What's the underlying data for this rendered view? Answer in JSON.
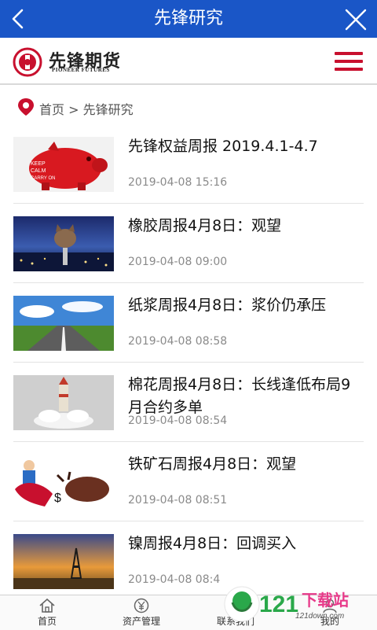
{
  "header": {
    "title": "先锋研究"
  },
  "brand": {
    "name_cn": "先锋期货",
    "name_en": "PIONEER FUTURES",
    "color": "#c8102e"
  },
  "colors": {
    "top_bar": "#1a56c7",
    "accent": "#c8102e"
  },
  "breadcrumb": {
    "text": "首页 > 先锋研究"
  },
  "articles": [
    {
      "title": "先锋权益周报 2019.4.1-4.7",
      "date": "2019-04-08 15:16",
      "thumb": "red-piggy-bank"
    },
    {
      "title": "橡胶周报4月8日：观望",
      "date": "2019-04-08 09:00",
      "thumb": "cat-city-night"
    },
    {
      "title": "纸浆周报4月8日：浆价仍承压",
      "date": "2019-04-08 08:58",
      "thumb": "road-sky"
    },
    {
      "title": "棉花周报4月8日：长线逢低布局9月合约多单",
      "date": "2019-04-08 08:54",
      "thumb": "rocket-cotton"
    },
    {
      "title": "铁矿石周报4月8日：观望",
      "date": "2019-04-08 08:51",
      "thumb": "matador-bull"
    },
    {
      "title": "镍周报4月8日：回调买入",
      "date": "2019-04-08 08:4",
      "thumb": "oil-rig-sunset"
    }
  ],
  "tabbar": [
    {
      "label": "首页",
      "icon": "home-icon"
    },
    {
      "label": "资产管理",
      "icon": "yen-icon"
    },
    {
      "label": "联系我们",
      "icon": "contact-icon"
    },
    {
      "label": "我的",
      "icon": "profile-icon"
    }
  ],
  "watermark": {
    "number": "121",
    "text_cn": "下载站",
    "domain": "121down.com"
  }
}
